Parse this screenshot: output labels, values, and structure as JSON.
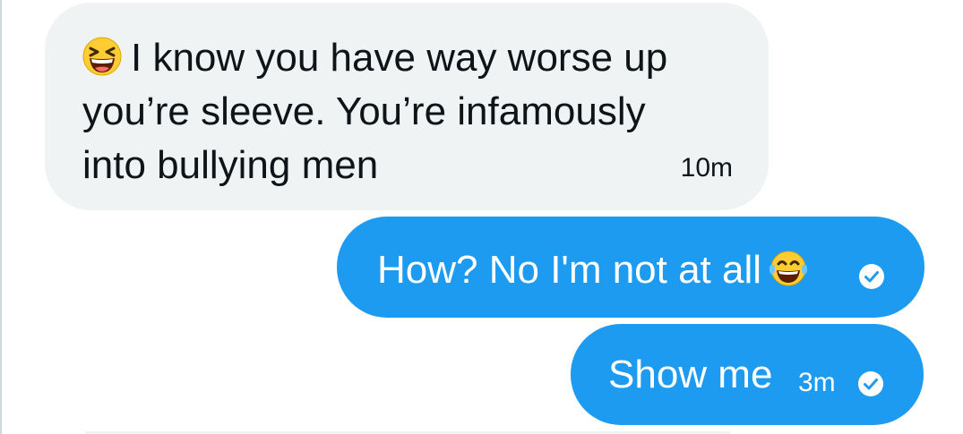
{
  "messages": [
    {
      "direction": "incoming",
      "emoji": "grinning-squinting-face-icon",
      "text": "I know you have way worse up\nyou’re sleeve. You’re infamously\ninto bullying men",
      "time": "10m"
    },
    {
      "direction": "outgoing",
      "text": "How? No I'm not at all",
      "emoji": "face-with-tears-of-joy-icon",
      "time": "",
      "status_icon": "sent-check-icon"
    },
    {
      "direction": "outgoing",
      "text": "Show me",
      "time": "3m",
      "status_icon": "sent-check-icon"
    }
  ],
  "colors": {
    "outgoing_bubble": "#1d9bf0",
    "incoming_bubble": "#eff3f4",
    "text_dark": "#0f1419"
  }
}
